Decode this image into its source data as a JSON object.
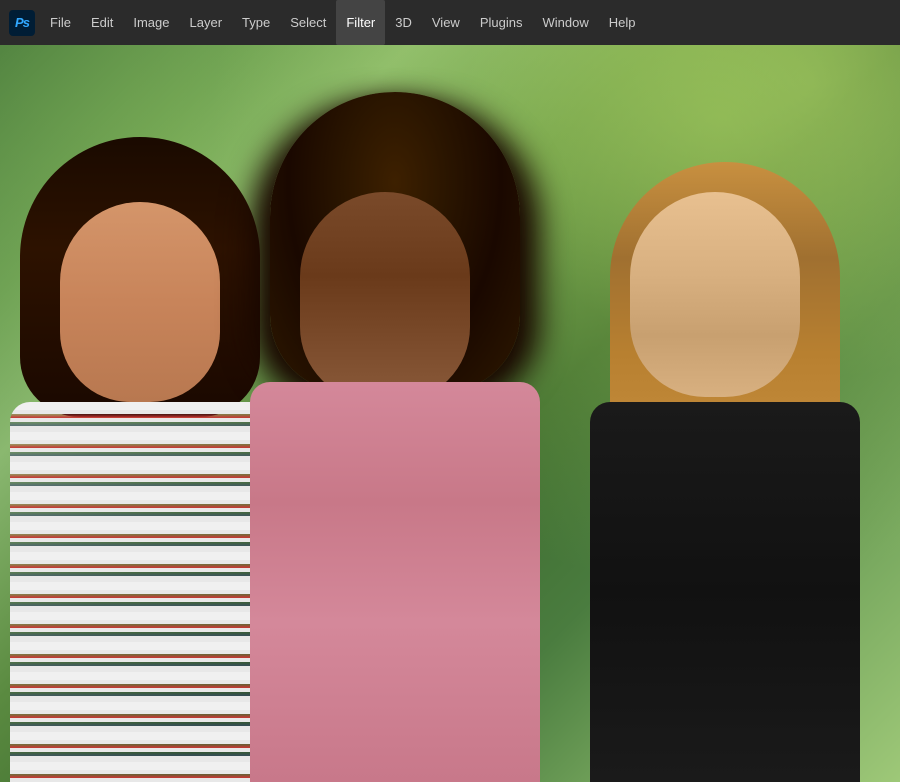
{
  "app": {
    "logo_text": "Ps"
  },
  "menubar": {
    "items": [
      {
        "id": "file",
        "label": "File",
        "active": false
      },
      {
        "id": "edit",
        "label": "Edit",
        "active": false
      },
      {
        "id": "image",
        "label": "Image",
        "active": false
      },
      {
        "id": "layer",
        "label": "Layer",
        "active": false
      },
      {
        "id": "type",
        "label": "Type",
        "active": false
      },
      {
        "id": "select",
        "label": "Select",
        "active": false
      },
      {
        "id": "filter",
        "label": "Filter",
        "active": true
      },
      {
        "id": "3d",
        "label": "3D",
        "active": false
      },
      {
        "id": "view",
        "label": "View",
        "active": false
      },
      {
        "id": "plugins",
        "label": "Plugins",
        "active": false
      },
      {
        "id": "window",
        "label": "Window",
        "active": false
      },
      {
        "id": "help",
        "label": "Help",
        "active": false
      }
    ]
  },
  "colors": {
    "menubar_bg": "#2b2b2b",
    "menubar_text": "#cccccc",
    "active_item_bg": "#444444",
    "logo_bg": "#001d35",
    "logo_text_color": "#31a8ff"
  }
}
